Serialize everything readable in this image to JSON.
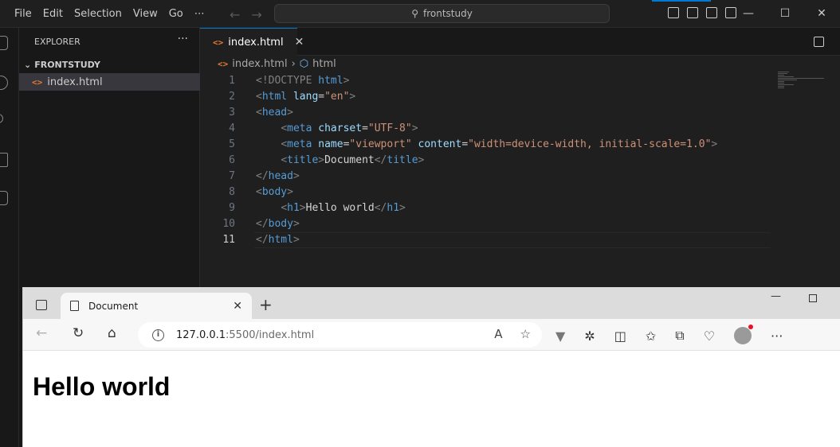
{
  "vscode": {
    "menu": [
      "File",
      "Edit",
      "Selection",
      "View",
      "Go",
      "⋯"
    ],
    "command_center": "frontstudy",
    "window_controls": [
      "—",
      "☐",
      "✕"
    ],
    "explorer_title": "EXPLORER",
    "explorer_more": "···",
    "folder": "FRONTSTUDY",
    "file": "index.html",
    "tab": {
      "label": "index.html",
      "close": "✕"
    },
    "breadcrumb": [
      "index.html",
      "html"
    ],
    "code_lines": [
      {
        "n": "1",
        "html": "<span class='t-br'>&lt;!DOCTYPE</span> <span class='t-tag'>html</span><span class='t-br'>&gt;</span>"
      },
      {
        "n": "2",
        "html": "<span class='t-br'>&lt;</span><span class='t-tag'>html</span> <span class='t-attr'>lang</span>=<span class='t-str'>\"en\"</span><span class='t-br'>&gt;</span>"
      },
      {
        "n": "3",
        "html": "<span class='t-br'>&lt;</span><span class='t-tag'>head</span><span class='t-br'>&gt;</span>"
      },
      {
        "n": "4",
        "html": "    <span class='t-br'>&lt;</span><span class='t-tag'>meta</span> <span class='t-attr'>charset</span>=<span class='t-str'>\"UTF-8\"</span><span class='t-br'>&gt;</span>"
      },
      {
        "n": "5",
        "html": "    <span class='t-br'>&lt;</span><span class='t-tag'>meta</span> <span class='t-attr'>name</span>=<span class='t-str'>\"viewport\"</span> <span class='t-attr'>content</span>=<span class='t-str'>\"width=device-width, initial-scale=1.0\"</span><span class='t-br'>&gt;</span>"
      },
      {
        "n": "6",
        "html": "    <span class='t-br'>&lt;</span><span class='t-tag'>title</span><span class='t-br'>&gt;</span><span class='t-txt'>Document</span><span class='t-br'>&lt;/</span><span class='t-tag'>title</span><span class='t-br'>&gt;</span>"
      },
      {
        "n": "7",
        "html": "<span class='t-br'>&lt;/</span><span class='t-tag'>head</span><span class='t-br'>&gt;</span>"
      },
      {
        "n": "8",
        "html": "<span class='t-br'>&lt;</span><span class='t-tag'>body</span><span class='t-br'>&gt;</span>"
      },
      {
        "n": "9",
        "html": "    <span class='t-br'>&lt;</span><span class='t-tag'>h1</span><span class='t-br'>&gt;</span><span class='t-txt'>Hello world</span><span class='t-br'>&lt;/</span><span class='t-tag'>h1</span><span class='t-br'>&gt;</span>"
      },
      {
        "n": "10",
        "html": "<span class='t-br'>&lt;/</span><span class='t-tag'>body</span><span class='t-br'>&gt;</span>"
      },
      {
        "n": "11",
        "html": "<span class='t-br'>&lt;/</span><span class='t-tag'>html</span><span class='t-br'>&gt;</span>"
      }
    ],
    "active_line": "11"
  },
  "browser": {
    "tab_title": "Document",
    "tab_close": "✕",
    "new_tab": "+",
    "url_host": "127.0.0.1",
    "url_path": ":5500/index.html",
    "more": "···",
    "page_heading": "Hello world"
  }
}
